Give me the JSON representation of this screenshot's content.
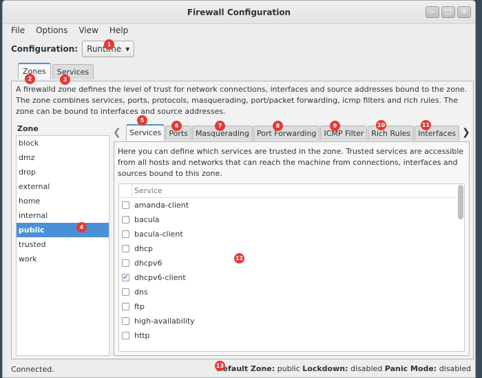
{
  "window": {
    "title": "Firewall Configuration",
    "buttons": [
      "–",
      "□",
      "✕"
    ]
  },
  "menu": [
    "File",
    "Options",
    "View",
    "Help"
  ],
  "config": {
    "label": "Configuration:",
    "value": "Runtime"
  },
  "outer_tabs": [
    "Zones",
    "Services"
  ],
  "zone_description": "A firewalld zone defines the level of trust for network connections, interfaces and source addresses bound to the zone. The zone combines services, ports, protocols, masquerading, port/packet forwarding, icmp filters and rich rules. The zone can be bound to interfaces and source addresses.",
  "zone_list_title": "Zone",
  "zones": [
    "block",
    "dmz",
    "drop",
    "external",
    "home",
    "internal",
    "public",
    "trusted",
    "work"
  ],
  "selected_zone": "public",
  "inner_tabs": [
    "Services",
    "Ports",
    "Masquerading",
    "Port Forwarding",
    "ICMP Filter",
    "Rich Rules",
    "Interfaces"
  ],
  "services_description": "Here you can define which services are trusted in the zone. Trusted services are accessible from all hosts and networks that can reach the machine from connections, interfaces and sources bound to this zone.",
  "services_header": "Service",
  "services": [
    {
      "name": "amanda-client",
      "checked": false
    },
    {
      "name": "bacula",
      "checked": false
    },
    {
      "name": "bacula-client",
      "checked": false
    },
    {
      "name": "dhcp",
      "checked": false
    },
    {
      "name": "dhcpv6",
      "checked": false
    },
    {
      "name": "dhcpv6-client",
      "checked": true
    },
    {
      "name": "dns",
      "checked": false
    },
    {
      "name": "ftp",
      "checked": false
    },
    {
      "name": "high-availability",
      "checked": false
    },
    {
      "name": "http",
      "checked": false
    }
  ],
  "status": {
    "left": "Connected.",
    "default_zone_label": "Default Zone:",
    "default_zone_value": "public",
    "lockdown_label": "Lockdown:",
    "lockdown_value": "disabled",
    "panic_label": "Panic Mode:",
    "panic_value": "disabled"
  },
  "badges": [
    "1",
    "2",
    "3",
    "4",
    "5",
    "6",
    "7",
    "8",
    "9",
    "10",
    "11",
    "12",
    "13"
  ]
}
